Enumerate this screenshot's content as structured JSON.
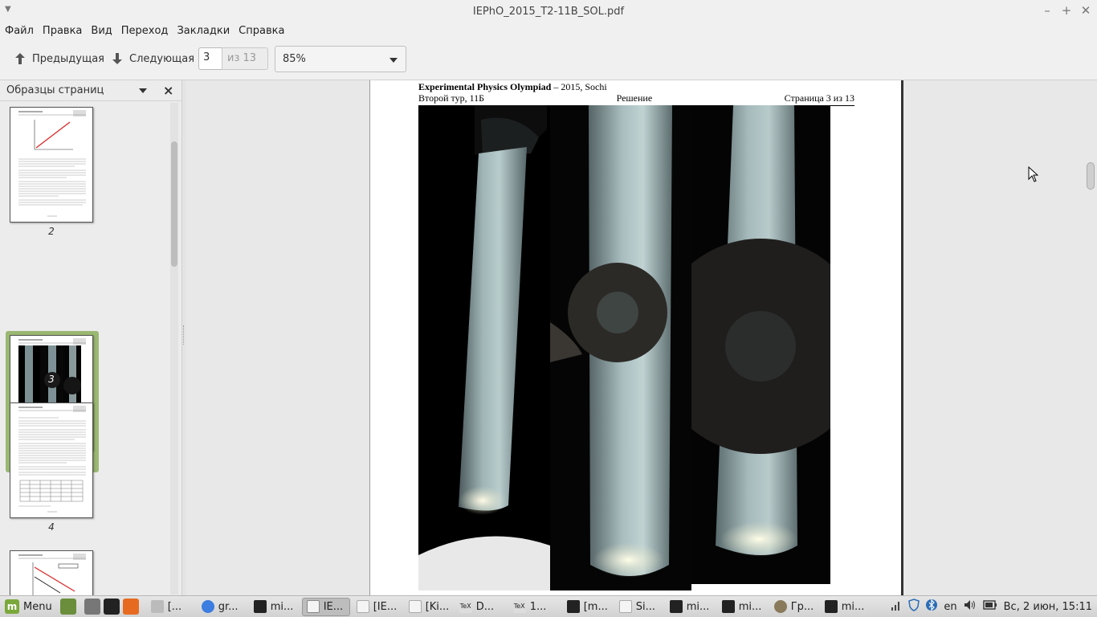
{
  "window": {
    "title": "IEPhO_2015_T2-11B_SOL.pdf",
    "minimize_icon": "minimize-icon",
    "maximize_icon": "maximize-icon",
    "close_icon": "close-icon"
  },
  "menu": {
    "items": [
      "Файл",
      "Правка",
      "Вид",
      "Переход",
      "Закладки",
      "Справка"
    ]
  },
  "toolbar": {
    "prev_label": "Предыдущая",
    "next_label": "Следующая",
    "page_value": "3",
    "page_total": "из 13",
    "zoom": "85%"
  },
  "sidebar": {
    "title": "Образцы страниц",
    "thumbnails": [
      {
        "label": "2"
      },
      {
        "label": "3",
        "selected": true
      },
      {
        "label": "4"
      },
      {
        "label": ""
      }
    ]
  },
  "document": {
    "header_bold": "Experimental Physics Olympiad",
    "header_rest": " – 2015, Sochi",
    "header_left": "Второй тур, 11Б",
    "header_center": "Решение",
    "header_right": "Страница 3 из 13"
  },
  "taskbar": {
    "menu_label": "Menu",
    "apps": [
      {
        "label": "[...",
        "icon": "file-manager-icon"
      },
      {
        "label": "gr...",
        "icon": "chrome-icon"
      },
      {
        "label": "mi...",
        "icon": "terminal-icon"
      },
      {
        "label": "IE...",
        "icon": "pdf-icon",
        "active": true
      },
      {
        "label": "[IE...",
        "icon": "document-icon"
      },
      {
        "label": "[Ki...",
        "icon": "document-icon"
      },
      {
        "label": "D...",
        "icon": "tex-icon"
      },
      {
        "label": "1...",
        "icon": "tex-icon"
      },
      {
        "label": "[m...",
        "icon": "terminal-icon"
      },
      {
        "label": "Si...",
        "icon": "document-icon"
      },
      {
        "label": "mi...",
        "icon": "terminal-icon"
      },
      {
        "label": "mi...",
        "icon": "terminal-icon"
      },
      {
        "label": "Гр...",
        "icon": "gimp-icon"
      },
      {
        "label": "mi...",
        "icon": "terminal-icon"
      }
    ],
    "keyboard_layout": "en",
    "clock": "Вс, 2 июн, 15:11"
  }
}
